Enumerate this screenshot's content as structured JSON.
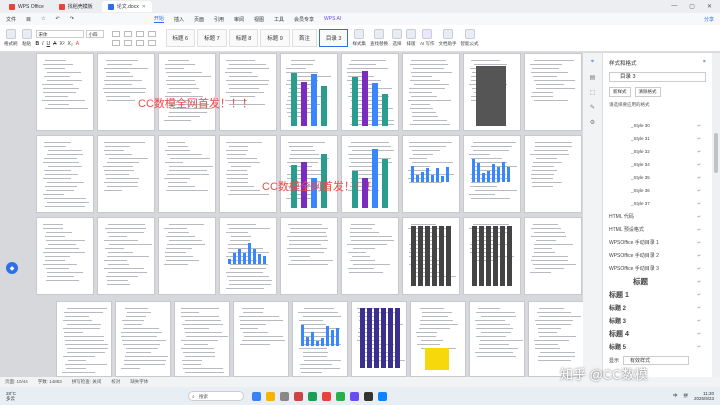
{
  "tabs": [
    {
      "label": "WPS Office",
      "color": "#e8433b"
    },
    {
      "label": "找稻壳模板",
      "color": "#e8433b"
    },
    {
      "label": "论文.docx",
      "color": "#2c6fe8"
    }
  ],
  "window_controls": [
    "—",
    "▢",
    "✕"
  ],
  "menu": {
    "left": [
      "文件",
      "目",
      "☆",
      "↶",
      "↷"
    ],
    "items": [
      "开始",
      "插入",
      "页面",
      "引用",
      "审阅",
      "视图",
      "工具",
      "会员专享"
    ],
    "wps_ai": "WPS AI",
    "active": "开始",
    "right_buttons": [
      "分享"
    ]
  },
  "ribbon": {
    "left_buttons": [
      {
        "label": "格式刷"
      },
      {
        "label": "粘贴"
      }
    ],
    "font_name": "宋体",
    "font_size": "小四",
    "format_glyphs": [
      "B",
      "I",
      "U",
      "A",
      "X²",
      "X₂",
      "A"
    ],
    "styles": [
      "标题 6",
      "标题 7",
      "标题 8",
      "标题 9",
      "首注",
      "目录 3"
    ],
    "selected_style": "目录 3",
    "right_buttons": [
      {
        "label": "样式集"
      },
      {
        "label": "查找替换"
      },
      {
        "label": "选择"
      },
      {
        "label": "排版"
      },
      {
        "label": "AI 写作"
      },
      {
        "label": "文档助手"
      },
      {
        "label": "智能公式"
      }
    ]
  },
  "overlay_texts": [
    "CC数模全网首发！！！",
    "CC数模全网首发！！！"
  ],
  "panel": {
    "title": "样式和格式",
    "close": "×",
    "current_style": "目录 3",
    "buttons": [
      "新样式",
      "清除格式"
    ],
    "hint": "请选择要应用的格式",
    "styles": [
      {
        "label": "_Style 30",
        "size": 4.5,
        "bold": false
      },
      {
        "label": "_Style 31",
        "size": 4.5,
        "bold": false
      },
      {
        "label": "_Style 32",
        "size": 4.5,
        "bold": false
      },
      {
        "label": "_Style 34",
        "size": 4.5,
        "bold": false
      },
      {
        "label": "_Style 35",
        "size": 4.5,
        "bold": false
      },
      {
        "label": "_Style 36",
        "size": 4.5,
        "bold": false
      },
      {
        "label": "_Style 37",
        "size": 4.5,
        "bold": false
      },
      {
        "label": "HTML 代码",
        "size": 5,
        "bold": false
      },
      {
        "label": "HTML 预设格式",
        "size": 5,
        "bold": false
      },
      {
        "label": "WPSOffice 手动目录 1",
        "size": 5,
        "bold": false
      },
      {
        "label": "WPSOffice 手动目录 2",
        "size": 5,
        "bold": false
      },
      {
        "label": "WPSOffice 手动目录 3",
        "size": 5,
        "bold": false
      },
      {
        "label": "标题",
        "size": 7.5,
        "bold": true
      },
      {
        "label": "标题 1",
        "size": 7,
        "bold": true
      },
      {
        "label": "标题 2",
        "size": 6,
        "bold": true
      },
      {
        "label": "标题 3",
        "size": 6,
        "bold": true
      },
      {
        "label": "标题 4",
        "size": 7,
        "bold": true
      },
      {
        "label": "标题 5",
        "size": 6,
        "bold": true
      }
    ],
    "style_mark": "↵",
    "footer_label": "显示",
    "footer_value": "有效样式"
  },
  "status": [
    "页面: 10/44",
    "字数: 14883",
    "拼写检查: 关闭",
    "校对",
    "缺失字体"
  ],
  "taskbar": {
    "temp": "28°C",
    "weather": "多云",
    "search": "搜索",
    "tray": [
      "中",
      "拼"
    ],
    "time": "11:20",
    "date": "2025/9/23"
  },
  "watermark": "知乎 @CC数模"
}
